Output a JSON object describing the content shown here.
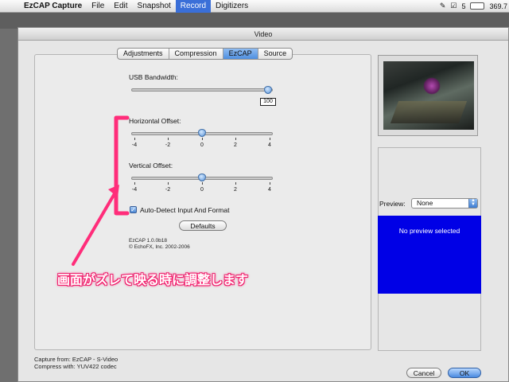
{
  "menubar": {
    "app_name": "EzCAP Capture",
    "items": [
      "File",
      "Edit",
      "Snapshot",
      "Record",
      "Digitizers"
    ],
    "active_item": "Record",
    "status_value": "5",
    "battery_text": "369.7"
  },
  "window": {
    "title": "Video",
    "tabs": [
      "Adjustments",
      "Compression",
      "EzCAP",
      "Source"
    ],
    "selected_tab": "EzCAP"
  },
  "usb": {
    "label": "USB Bandwidth:",
    "value": "100",
    "level": 1.0
  },
  "horizontal": {
    "label": "Horizontal Offset:",
    "ticks": [
      "-4",
      "-2",
      "0",
      "2",
      "4"
    ],
    "value": 0
  },
  "vertical": {
    "label": "Vertical Offset:",
    "ticks": [
      "-4",
      "-2",
      "0",
      "2",
      "4"
    ],
    "value": 0
  },
  "autodetect": {
    "label": "Auto-Detect Input And Format",
    "checked": true
  },
  "defaults_button": "Defaults",
  "version": {
    "line1": "EzCAP 1.0.0b18",
    "line2": "© EchoFX, Inc. 2002-2006"
  },
  "preview": {
    "label": "Preview:",
    "selected": "None",
    "message": "No preview selected"
  },
  "footer": {
    "capture_from": "Capture from: EzCAP - S-Video",
    "compress_with": "Compress with: YUV422 codec",
    "cancel": "Cancel",
    "ok": "OK"
  },
  "annotation": {
    "text": "画面がズレて映る時に調整します",
    "color": "#ff2d7a"
  }
}
